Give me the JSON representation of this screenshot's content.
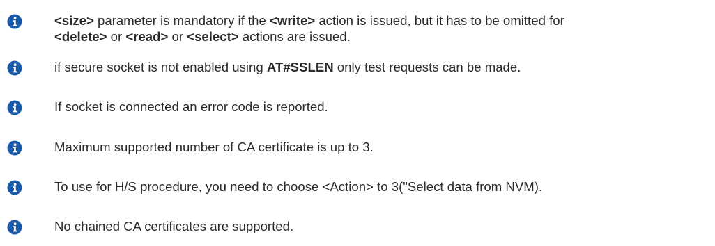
{
  "icon_color": "#1b5aa8",
  "icon_name": "info-icon",
  "notes": [
    {
      "line1": [
        {
          "t": "<size>",
          "b": true
        },
        {
          "t": " parameter is mandatory if the ",
          "b": false
        },
        {
          "t": "<write>",
          "b": true
        },
        {
          "t": " action is issued, but it has to be omitted for",
          "b": false
        }
      ],
      "line2": [
        {
          "t": "<delete>",
          "b": true
        },
        {
          "t": " or ",
          "b": false
        },
        {
          "t": "<read>",
          "b": true
        },
        {
          "t": "  or ",
          "b": false
        },
        {
          "t": "<select>",
          "b": true
        },
        {
          "t": " actions are issued.",
          "b": false
        }
      ]
    },
    {
      "line1": [
        {
          "t": "if secure socket is not enabled using ",
          "b": false
        },
        {
          "t": "AT#SSLEN",
          "b": true
        },
        {
          "t": " only test requests can be made.",
          "b": false
        }
      ]
    },
    {
      "line1": [
        {
          "t": "If socket is connected an error code is reported.",
          "b": false
        }
      ]
    },
    {
      "line1": [
        {
          "t": "Maximum supported number of CA certificate is up to 3.",
          "b": false
        }
      ]
    },
    {
      "line1": [
        {
          "t": "To use for H/S procedure, you need to choose <Action> to 3(\"Select data from NVM).",
          "b": false
        }
      ]
    },
    {
      "line1": [
        {
          "t": "No chained CA certificates are supported.",
          "b": false
        }
      ]
    }
  ]
}
